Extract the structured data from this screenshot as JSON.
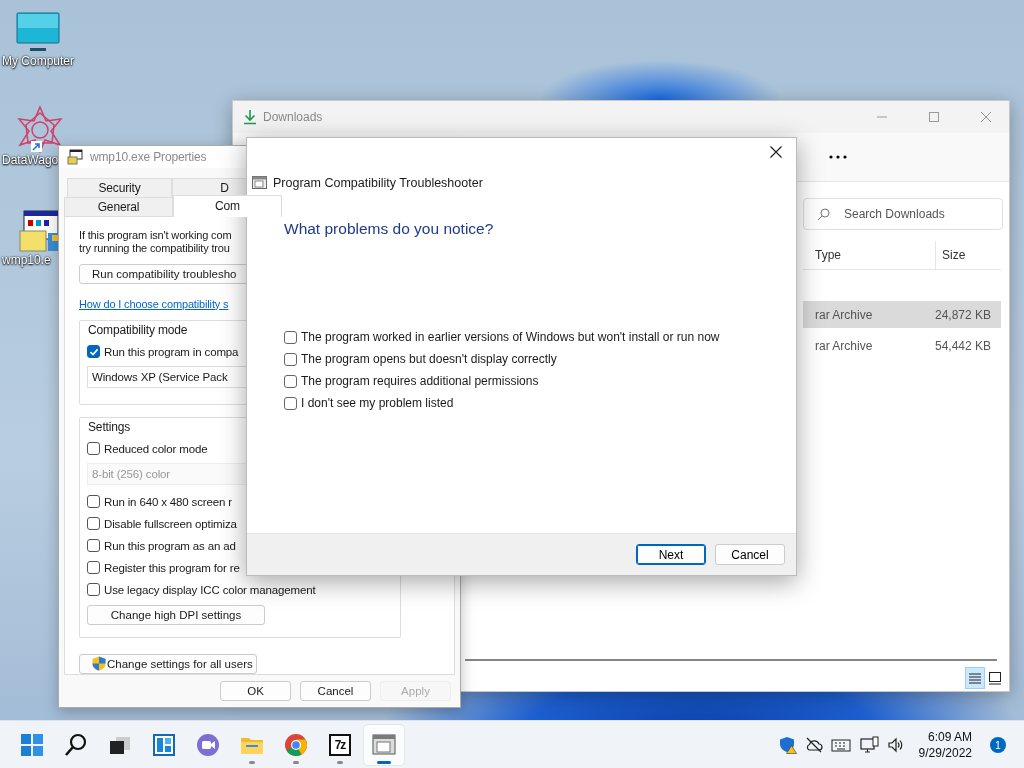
{
  "desktop_icons": [
    {
      "kind": "monitor",
      "label": "My Computer"
    },
    {
      "kind": "star",
      "label": "DataWago",
      "shortcut": true
    },
    {
      "kind": "app",
      "label": "wmp10.e",
      "shortcut": false
    }
  ],
  "downloads_window": {
    "title": "Downloads",
    "search": {
      "placeholder": "Search Downloads"
    },
    "columns": [
      "Type",
      "Size"
    ],
    "rows": [
      {
        "type": "rar Archive",
        "size": "24,872 KB",
        "selected": true
      },
      {
        "type": "rar Archive",
        "size": "54,442 KB",
        "selected": false
      }
    ],
    "views": [
      {
        "kind": "details",
        "selected": true
      },
      {
        "kind": "tiles",
        "selected": false
      }
    ]
  },
  "properties_window": {
    "title": "wmp10.exe Properties",
    "tab_rows": [
      [
        {
          "label": "Security",
          "selected": false
        },
        {
          "label": "D",
          "selected": false
        }
      ],
      [
        {
          "label": "General",
          "selected": false
        },
        {
          "label": "Com",
          "selected": true
        }
      ]
    ],
    "intro": [
      "If this program isn't working com",
      "try running the compatibility trou"
    ],
    "troubleshoot_button": "Run compatibility troublesho",
    "help_link": "How do I choose compatibility s",
    "compatibility_mode": {
      "title": "Compatibility mode",
      "checkbox": {
        "label": "Run this program in compa",
        "checked": true
      },
      "dropdown": {
        "value": "Windows XP (Service Pack",
        "disabled": false
      }
    },
    "settings": {
      "title": "Settings",
      "items": [
        {
          "kind": "checkbox",
          "label": "Reduced color mode",
          "checked": false
        },
        {
          "kind": "dropdown",
          "value": "8-bit (256) color",
          "disabled": true
        },
        {
          "kind": "checkbox",
          "label": "Run in 640 x 480 screen r",
          "checked": false
        },
        {
          "kind": "checkbox",
          "label": "Disable fullscreen optimiza",
          "checked": false
        },
        {
          "kind": "checkbox",
          "label": "Run this program as an ad",
          "checked": false
        },
        {
          "kind": "checkbox",
          "label": "Register this program for re",
          "checked": false
        },
        {
          "kind": "checkbox",
          "label": "Use legacy display ICC color management",
          "checked": false
        },
        {
          "kind": "button",
          "label": "Change high DPI settings"
        }
      ]
    },
    "all_users_button": "Change settings for all users",
    "buttons": [
      {
        "label": "OK",
        "disabled": false
      },
      {
        "label": "Cancel",
        "disabled": false
      },
      {
        "label": "Apply",
        "disabled": true
      }
    ]
  },
  "troubleshooter": {
    "title": "Program Compatibility Troubleshooter",
    "heading": "What problems do you notice?",
    "options": [
      {
        "label": "The program worked in earlier versions of Windows but won't install or run now",
        "checked": false
      },
      {
        "label": "The program opens but doesn't display correctly",
        "checked": false
      },
      {
        "label": "The program requires additional permissions",
        "checked": false
      },
      {
        "label": "I don't see my problem listed",
        "checked": false
      }
    ],
    "buttons": [
      {
        "label": "Next",
        "default": true
      },
      {
        "label": "Cancel",
        "default": false
      }
    ]
  },
  "taskbar": {
    "apps": [
      {
        "kind": "start",
        "running": false,
        "active": false
      },
      {
        "kind": "search",
        "running": false,
        "active": false
      },
      {
        "kind": "task-view",
        "running": false,
        "active": false
      },
      {
        "kind": "widgets",
        "running": false,
        "active": false
      },
      {
        "kind": "chat",
        "running": false,
        "active": false
      },
      {
        "kind": "explorer",
        "running": true,
        "active": false
      },
      {
        "kind": "chrome",
        "running": true,
        "active": false
      },
      {
        "kind": "archiver",
        "label": "7z",
        "running": true,
        "active": false
      },
      {
        "kind": "troubleshooter",
        "running": true,
        "active": true
      }
    ],
    "time": "6:09 AM",
    "date": "9/29/2022",
    "notifications": "1"
  }
}
